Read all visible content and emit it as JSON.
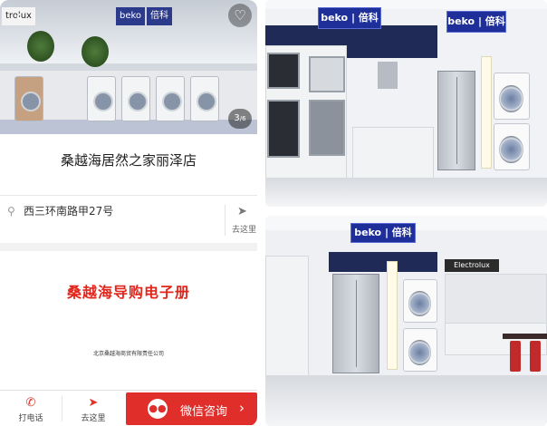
{
  "hero": {
    "signs": [
      "trolux",
      "beko",
      "倍科"
    ],
    "pager": {
      "current": "3",
      "total": "/6"
    },
    "icons": {
      "back": "chevron-left-icon",
      "favorite": "heart-outline-icon"
    }
  },
  "store": {
    "name": "桑越海居然之家丽泽店",
    "address": "西三环南路甲27号",
    "navigate_label": "去这里",
    "icons": {
      "location": "location-pin-icon",
      "navigate": "compass-icon"
    }
  },
  "ebook": {
    "title": "桑越海导购电子册",
    "company": "北京桑越海商贸有限责任公司"
  },
  "bottom_bar": {
    "call_label": "打电话",
    "go_label": "去这里",
    "wechat_label": "微信咨询",
    "colors": {
      "primary": "#e02e2b"
    }
  },
  "photos": {
    "top": {
      "signs": [
        "beko | 倍科",
        "beko | 倍科"
      ]
    },
    "bottom": {
      "signs": [
        "beko | 倍科",
        "Electrolux"
      ]
    }
  }
}
